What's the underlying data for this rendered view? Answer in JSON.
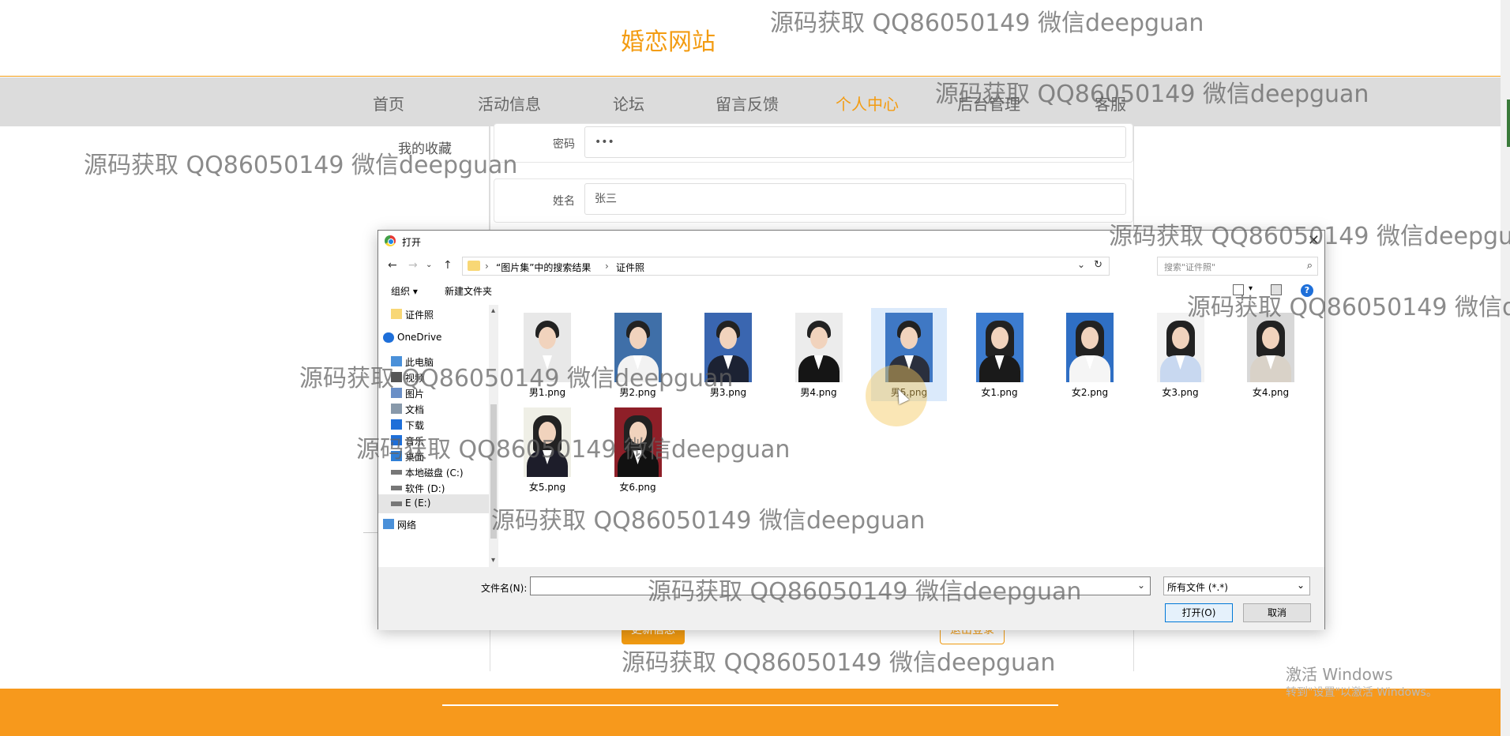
{
  "site": {
    "title": "婚恋网站"
  },
  "nav": {
    "items": [
      "首页",
      "活动信息",
      "论坛",
      "留言反馈",
      "个人中心",
      "后台管理",
      "客服"
    ],
    "active": "个人中心"
  },
  "sidebar_menu": {
    "item": "我的收藏"
  },
  "form": {
    "password_label": "密码",
    "password_value": "•••",
    "name_label": "姓名",
    "name_value": "张三",
    "update_button": "更新信息",
    "logout_button": "退出登录"
  },
  "dialog": {
    "title": "打开",
    "breadcrumb": [
      "“图片集”中的搜索结果",
      "证件照"
    ],
    "search_placeholder": "搜索\"证件照\"",
    "toolbar": {
      "organize": "组织 ▾",
      "new_folder": "新建文件夹"
    },
    "nav_items": [
      {
        "label": "证件照",
        "icon": "folder-icon"
      },
      {
        "label": "OneDrive",
        "icon": "cloud-icon"
      },
      {
        "label": "此电脑",
        "icon": "computer-icon"
      },
      {
        "label": "视频",
        "icon": "video-icon"
      },
      {
        "label": "图片",
        "icon": "picture-icon"
      },
      {
        "label": "文档",
        "icon": "document-icon"
      },
      {
        "label": "下载",
        "icon": "download-icon"
      },
      {
        "label": "音乐",
        "icon": "music-icon"
      },
      {
        "label": "桌面",
        "icon": "desktop-icon"
      },
      {
        "label": "本地磁盘 (C:)",
        "icon": "drive-icon"
      },
      {
        "label": "软件 (D:)",
        "icon": "drive-icon"
      },
      {
        "label": "E (E:)",
        "icon": "drive-icon"
      },
      {
        "label": "网络",
        "icon": "network-icon"
      }
    ],
    "files": [
      {
        "name": "男1.png",
        "bg": "#e8e8e8",
        "shirt": "#e8e8e8"
      },
      {
        "name": "男2.png",
        "bg": "#3f6fa8",
        "shirt": "#f2f2f2"
      },
      {
        "name": "男3.png",
        "bg": "#3a66b0",
        "shirt": "#1c2233"
      },
      {
        "name": "男4.png",
        "bg": "#ececec",
        "shirt": "#151515"
      },
      {
        "name": "男5.png",
        "bg": "#3f78c4",
        "shirt": "#2a2f3d"
      },
      {
        "name": "女1.png",
        "bg": "#3c7cd0",
        "shirt": "#1a1a1a"
      },
      {
        "name": "女2.png",
        "bg": "#2f6fc4",
        "shirt": "#f5f5f5"
      },
      {
        "name": "女3.png",
        "bg": "#f2f2f2",
        "shirt": "#c8d8f0"
      },
      {
        "name": "女4.png",
        "bg": "#d8d8d8",
        "shirt": "#d9d2c8"
      },
      {
        "name": "女5.png",
        "bg": "#efefe6",
        "shirt": "#1d1d2a"
      },
      {
        "name": "女6.png",
        "bg": "#8e1f28",
        "shirt": "#111111"
      }
    ],
    "selected_file": "男5.png",
    "filename_label": "文件名(N):",
    "filename_value": "",
    "filetype": "所有文件 (*.*)",
    "open_button": "打开(O)",
    "cancel_button": "取消"
  },
  "windows": {
    "activate": "激活 Windows",
    "activate_sub": "转到\"设置\"以激活 Windows。"
  },
  "watermark": "源码获取 QQ86050149 微信deepguan"
}
